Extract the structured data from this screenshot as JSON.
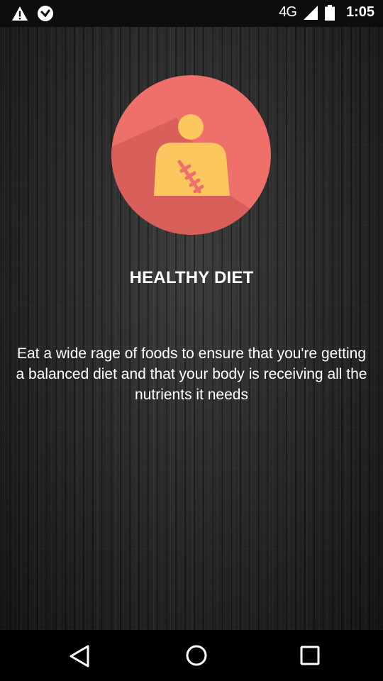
{
  "status_bar": {
    "network": "4G",
    "time": "1:05",
    "icons": [
      "warning-icon",
      "data-saver-icon",
      "signal-icon",
      "battery-icon"
    ]
  },
  "slide": {
    "title": "HEALTHY DIET",
    "description": "Eat a wide rage of foods to ensure that you're getting a balanced diet and that your body is receiving all the nutrients it needs",
    "icon": "person-with-stitches-icon",
    "colors": {
      "circle": "#ef706b",
      "shadow": "#d95f5b",
      "figure": "#fdc75f",
      "stitches": "#ef706b"
    }
  },
  "nav_bar": {
    "icons": [
      "back-icon",
      "home-icon",
      "recents-icon"
    ]
  }
}
